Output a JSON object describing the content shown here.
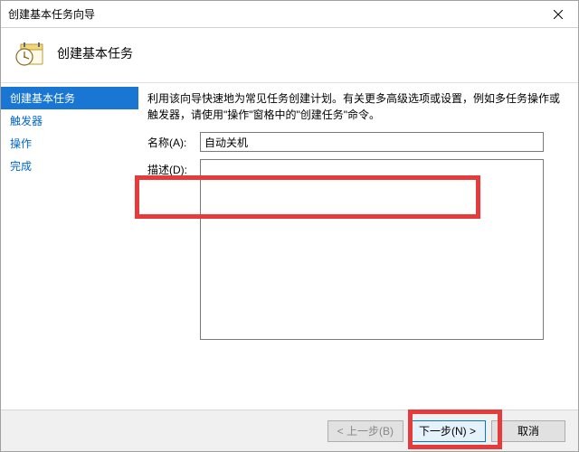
{
  "window": {
    "title": "创建基本任务向导"
  },
  "header": {
    "title": "创建基本任务"
  },
  "sidebar": {
    "items": [
      {
        "label": "创建基本任务",
        "active": true
      },
      {
        "label": "触发器",
        "active": false
      },
      {
        "label": "操作",
        "active": false
      },
      {
        "label": "完成",
        "active": false
      }
    ]
  },
  "main": {
    "intro": "利用该向导快速地为常见任务创建计划。有关更多高级选项或设置，例如多任务操作或触发器，请使用\"操作\"窗格中的\"创建任务\"命令。",
    "name_label": "名称(A):",
    "name_value": "自动关机",
    "desc_label": "描述(D):",
    "desc_value": ""
  },
  "footer": {
    "back": "< 上一步(B)",
    "next": "下一步(N) >",
    "cancel": "取消"
  }
}
